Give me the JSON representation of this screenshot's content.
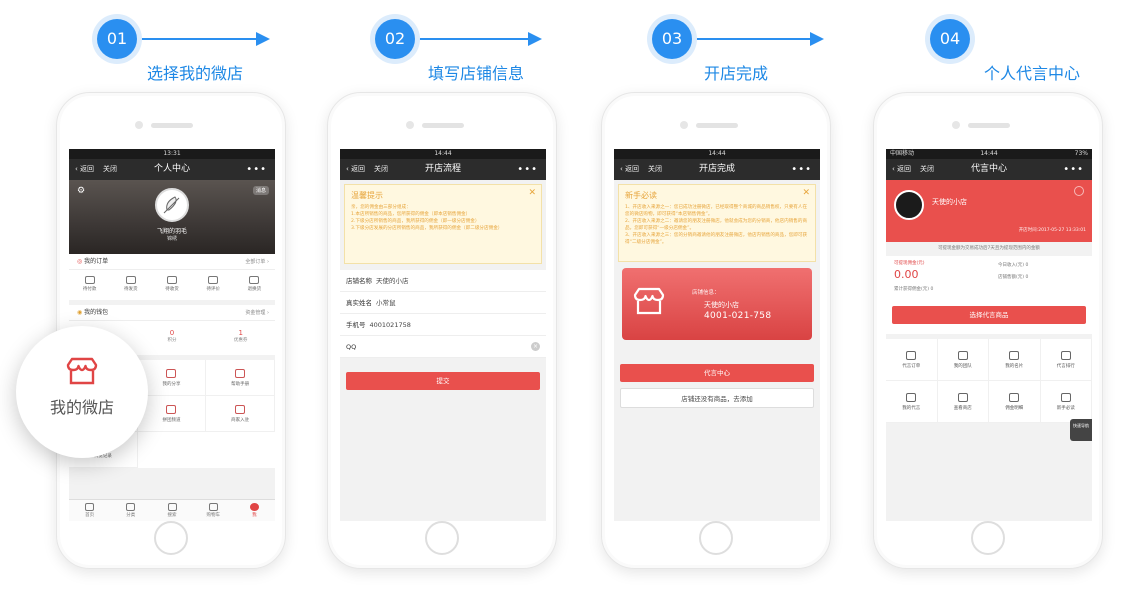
{
  "steps": [
    {
      "num": "01",
      "label": "选择我的微店"
    },
    {
      "num": "02",
      "label": "填写店铺信息"
    },
    {
      "num": "03",
      "label": "开店完成"
    },
    {
      "num": "04",
      "label": "个人代言中心"
    }
  ],
  "colors": {
    "accent_blue": "#2a8ff0",
    "brand_red": "#e9504d",
    "tip_orange": "#e7a53c"
  },
  "nav": {
    "back": "返回",
    "close": "关闭",
    "more": "•••"
  },
  "phone1": {
    "time": "13:31",
    "title": "个人中心",
    "msg": "消息",
    "user_name": "飞翔的羽毛",
    "user_sub": "锦绣",
    "orders_head": "我的订单",
    "orders_all": "全部订单",
    "orders": [
      "待付款",
      "待发货",
      "待收货",
      "待评价",
      "退换货"
    ],
    "wallet_head": "我的钱包",
    "wallet_manage": "资金管理",
    "wallet": [
      {
        "value": "0",
        "label": "红包"
      },
      {
        "value": "0",
        "label": "积分"
      },
      {
        "value": "1",
        "label": "优惠券"
      }
    ],
    "grid": [
      "我的微店",
      "我的分享",
      "帮助手册",
      "我的收藏",
      "拼团频道",
      "商家入驻",
      "浏览记录"
    ],
    "tabs": [
      "首页",
      "分类",
      "搜索",
      "购物车",
      "我"
    ],
    "magnifier_label": "我的微店"
  },
  "phone2": {
    "time": "14:44",
    "title": "开店流程",
    "tip_title": "温馨提示",
    "tip_lines": [
      "亲，您的佣金由三部分组成：",
      "1.本店所销售的商品，您所获得的佣金（即本店销售佣金）",
      "2.下级分店所销售的商品，我所获得的佣金（即一级分店佣金）",
      "3.下级分店发展的分店所销售的商品，我所获得的佣金（即二级分店佣金）"
    ],
    "fields": [
      {
        "label": "店铺名称",
        "value": "天使的小店"
      },
      {
        "label": "真实姓名",
        "value": "小常鼠"
      },
      {
        "label": "手机号",
        "value": "4001021758"
      },
      {
        "label": "QQ",
        "value": ""
      }
    ],
    "submit": "提交"
  },
  "phone3": {
    "time": "14:44",
    "title": "开店完成",
    "tip_title": "新手必读",
    "tip_lines": [
      "1、开店收入来源之一：您已成功注册微店，已经取得整个商城的商品销售权，只要有人在您的微店购物，即可获得“本店销售佣金”。",
      "2、开店收入来源之二：邀请您的朋友注册微店，他就会成为您的分销商，他店内销售的商品，您即可获得“一级分店佣金”。",
      "3、开店收入来源之三：您的分销商邀请他的朋友注册微店，他店内销售的商品，您即可获得“二级分店佣金”。"
    ],
    "card_label": "店铺信息：",
    "card_name": "天使的小店",
    "card_phone": "4001-021-758",
    "btn_center": "代言中心",
    "btn_add": "店铺还没有商品，去添加"
  },
  "phone4": {
    "carrier": "中国移动",
    "time": "14:44",
    "battery": "73%",
    "title": "代言中心",
    "shop": "天使的小店",
    "opened": "开店时间:2017-05-27 13:33:01",
    "note": "可提现金额为交易成功后7天且为提现范围内的金额",
    "withdrawable_label": "可提现佣金(元)",
    "withdrawable": "0.00",
    "total_label": "累计获得佣金(元) 0",
    "today": "今日收入(元) 0",
    "total_sales": "店铺售额(元) 0",
    "select_btn": "选择代言商品",
    "grid": [
      "代言订单",
      "我的团队",
      "我的名片",
      "代言排行",
      "我的代言",
      "查看商店",
      "佣金明细",
      "新手必读"
    ],
    "side_tab": "快速导航"
  }
}
